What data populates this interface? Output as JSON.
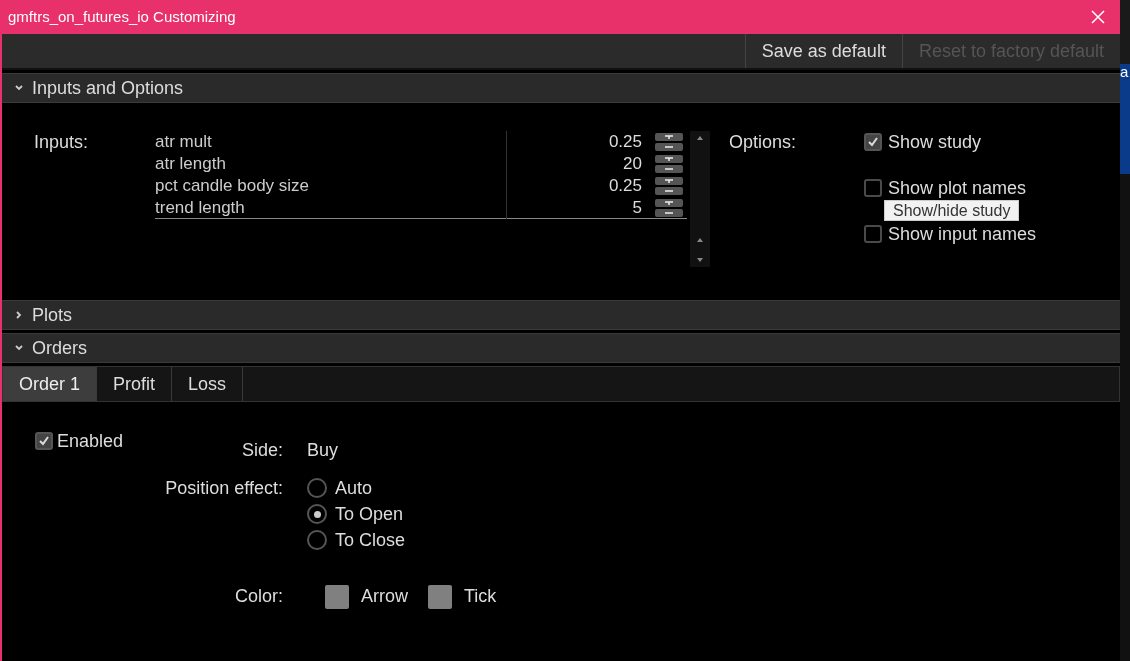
{
  "window": {
    "title": "gmftrs_on_futures_io Customizing"
  },
  "toolbar": [
    {
      "label": "Save as default",
      "disabled": false
    },
    {
      "label": "Reset to factory default",
      "disabled": true
    }
  ],
  "background_app": {
    "text": "a"
  },
  "sections": [
    {
      "kind": "inputs",
      "title": "Inputs and Options",
      "expanded": true,
      "inputs_label": "Inputs:",
      "inputs": [
        {
          "name": "atr mult",
          "value": "0.25"
        },
        {
          "name": "atr length",
          "value": "20"
        },
        {
          "name": "pct candle body size",
          "value": "0.25"
        },
        {
          "name": "trend length",
          "value": "5"
        }
      ],
      "options_label": "Options:",
      "options": [
        {
          "label": "Show study",
          "checked": true
        },
        {
          "label": "Show plot names",
          "checked": false
        },
        {
          "label": "Show input names",
          "checked": false
        }
      ],
      "tooltip": "Show/hide study"
    },
    {
      "title": "Plots",
      "expanded": false
    },
    {
      "kind": "orders",
      "title": "Orders",
      "expanded": true,
      "tabs": [
        {
          "label": "Order 1",
          "selected": true
        },
        {
          "label": "Profit",
          "selected": false
        },
        {
          "label": "Loss",
          "selected": false
        }
      ],
      "enabled": {
        "label": "Enabled",
        "checked": true
      },
      "side_label": "Side:",
      "side": "Buy",
      "position_label": "Position effect:",
      "positions": [
        {
          "label": "Auto",
          "selected": false
        },
        {
          "label": "To Open",
          "selected": true
        },
        {
          "label": "To Close",
          "selected": false
        }
      ],
      "color_label": "Color:",
      "colors": [
        {
          "label": "Arrow",
          "color": "#808080"
        },
        {
          "label": "Tick",
          "color": "#808080"
        }
      ]
    }
  ]
}
